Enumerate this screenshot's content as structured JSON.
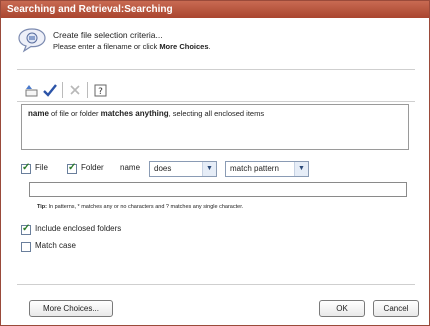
{
  "window": {
    "title": "Searching and Retrieval:Searching"
  },
  "header": {
    "line1": "Create file selection criteria...",
    "line2_prefix": "Please enter a filename or click ",
    "line2_bold": "More Choices",
    "line2_suffix": "."
  },
  "toolbar": {
    "icons": [
      "open-icon",
      "check-icon",
      "delete-icon",
      "help-icon"
    ]
  },
  "description": {
    "part1_bold": "name",
    "part2": " of file or folder ",
    "part3_bold": "matches anything",
    "part4": ", selecting all enclosed items"
  },
  "criteria": {
    "file_label": "File",
    "folder_label": "Folder",
    "field_label": "name",
    "operator_value": "does",
    "match_value": "match pattern",
    "pattern_value": ""
  },
  "tip": {
    "bold": "Tip:",
    "text": " In patterns, * matches any or no characters and ? matches any single character."
  },
  "options": {
    "include_enclosed": "Include enclosed folders",
    "match_case": "Match case"
  },
  "buttons": {
    "more_choices": "More Choices...",
    "ok": "OK",
    "cancel": "Cancel"
  }
}
